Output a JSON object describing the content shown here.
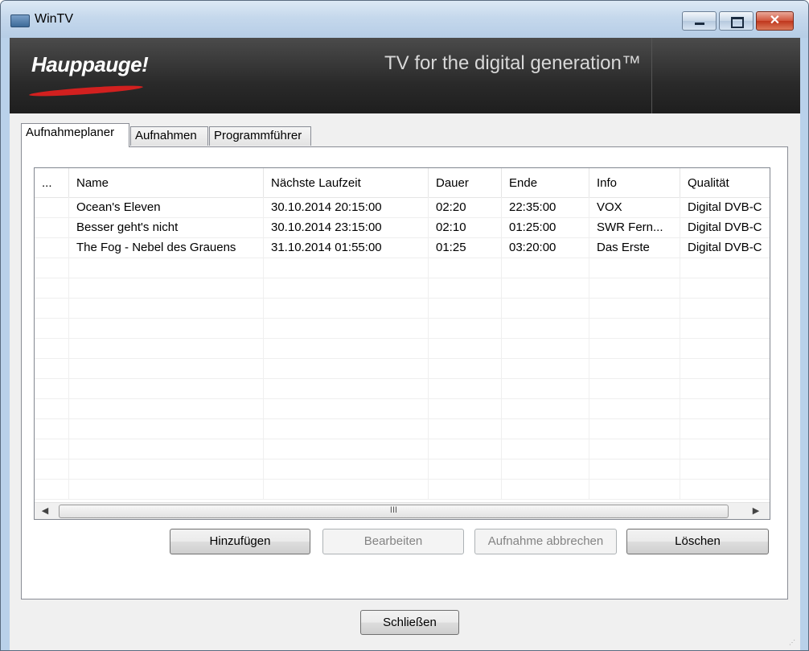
{
  "window": {
    "title": "WinTV",
    "controls": {
      "minimize": "–",
      "maximize": "□",
      "close": "✕"
    }
  },
  "banner": {
    "logo": "Hauppauge!",
    "slogan": "TV for the digital generation™"
  },
  "tabs": [
    {
      "label": "Aufnahmeplaner",
      "active": true
    },
    {
      "label": "Aufnahmen",
      "active": false
    },
    {
      "label": "Programmführer",
      "active": false
    }
  ],
  "table": {
    "columns": [
      "...",
      "Name",
      "Nächste Laufzeit",
      "Dauer",
      "Ende",
      "Info",
      "Qualität"
    ],
    "rows": [
      [
        "",
        "Ocean's Eleven",
        "30.10.2014 20:15:00",
        "02:20",
        "22:35:00",
        "VOX",
        "Digital DVB-C"
      ],
      [
        "",
        "Besser geht's nicht",
        "30.10.2014 23:15:00",
        "02:10",
        "01:25:00",
        "SWR Fern...",
        "Digital DVB-C"
      ],
      [
        "",
        "The Fog - Nebel des Grauens",
        "31.10.2014 01:55:00",
        "01:25",
        "03:20:00",
        "Das Erste",
        "Digital DVB-C"
      ]
    ],
    "scrollbar": {
      "left_arrow": "◀",
      "right_arrow": "▶",
      "thumb_grip": "III"
    }
  },
  "buttons": {
    "add": "Hinzufügen",
    "edit": "Bearbeiten",
    "cancel_recording": "Aufnahme abbrechen",
    "delete": "Löschen",
    "close": "Schließen"
  },
  "colors": {
    "banner_bg": "#2a2a2a",
    "logo_swoosh": "#d2201f",
    "window_frame": "#b9d1ea"
  }
}
